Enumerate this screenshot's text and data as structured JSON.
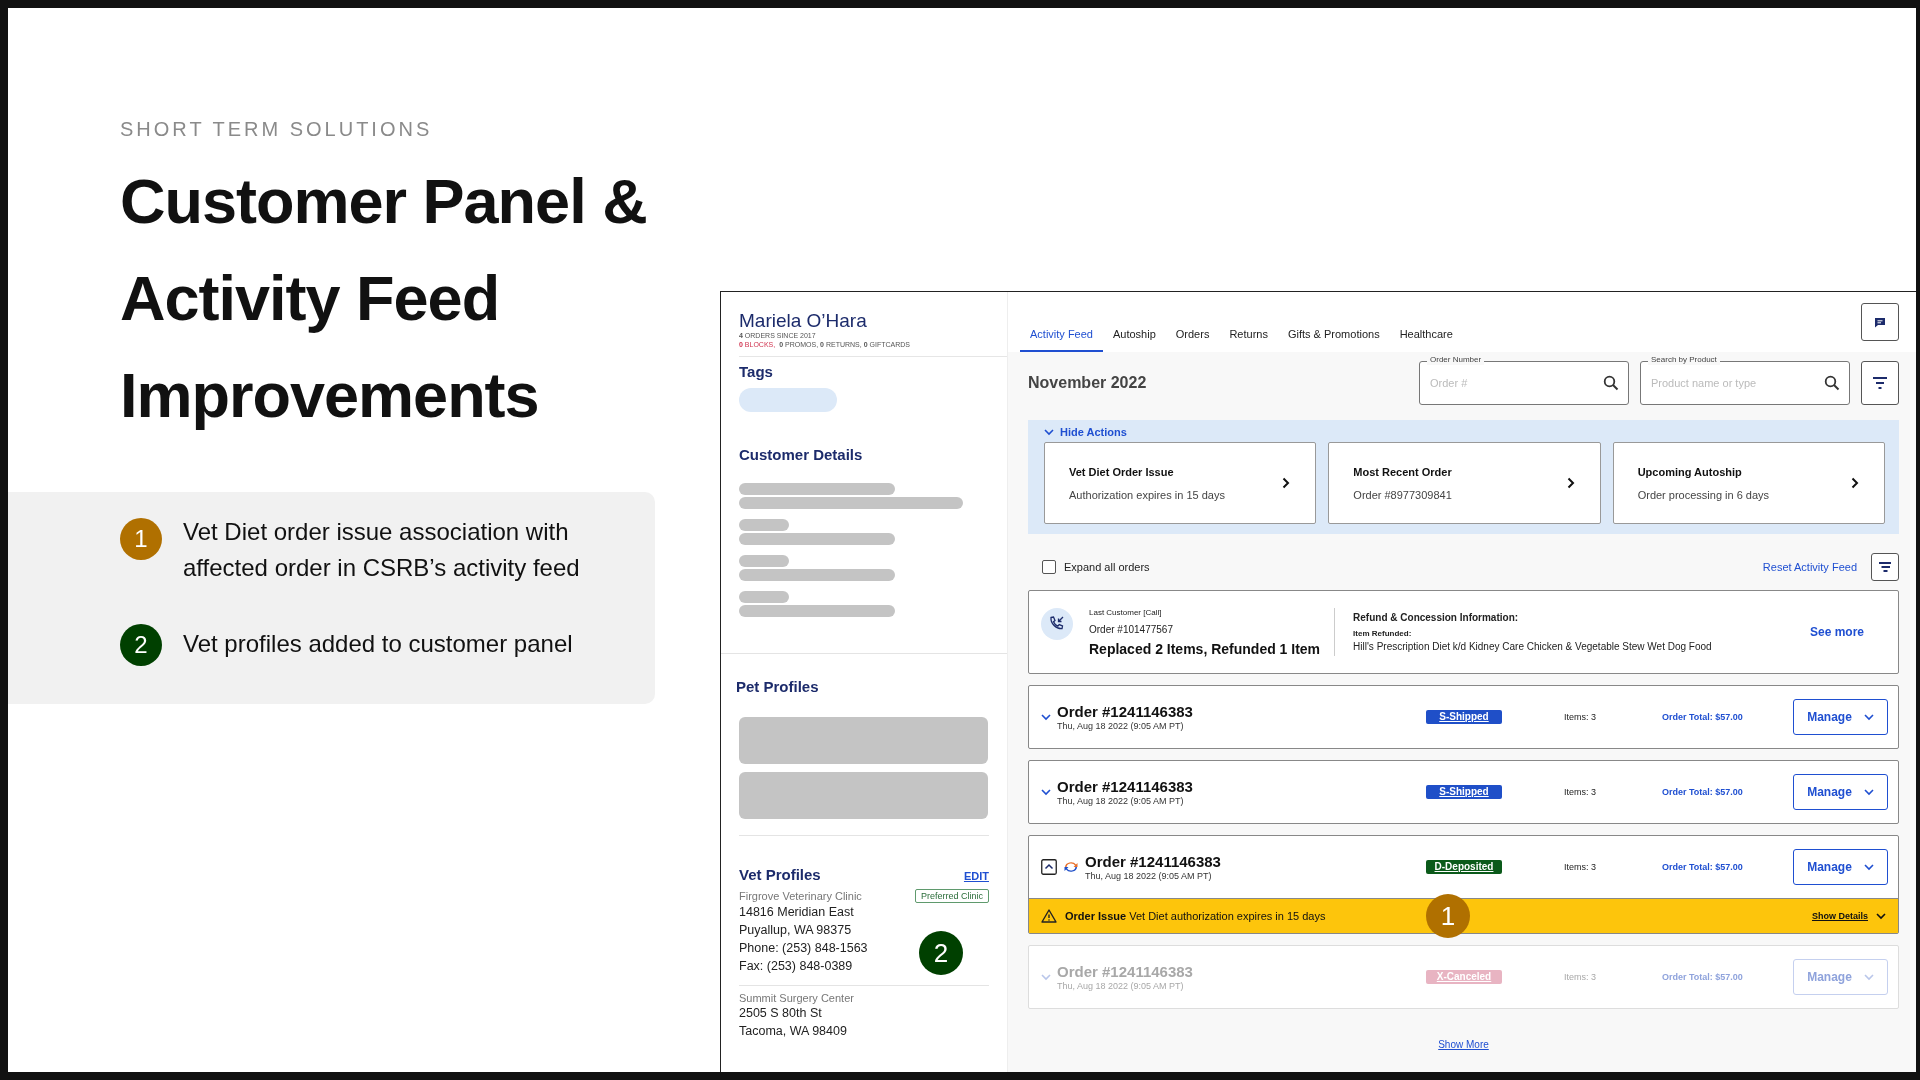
{
  "slide": {
    "eyebrow": "SHORT TERM SOLUTIONS",
    "title_lines": [
      "Customer Panel &",
      "Activity Feed",
      "Improvements"
    ],
    "notes": [
      {
        "marker": "1",
        "color": "#b07000",
        "text": "Vet Diet order issue association with affected order in CSRB’s activity feed"
      },
      {
        "marker": "2",
        "color": "#004000",
        "text": "Vet profiles added to customer panel"
      }
    ]
  },
  "customer_panel": {
    "name": "Mariela O’Hara",
    "summary": "**4** ORDERS SINCE 2017",
    "alerts": "**0** BLOCKS,",
    "counts": "**0** PROMOS, **0** RETURNS, **0** GIFTCARDS",
    "tags_heading": "Tags",
    "details_heading": "Customer Details",
    "pets_heading": "Pet Profiles",
    "vets_heading": "Vet Profiles",
    "vets_edit": "EDIT",
    "vets": [
      {
        "clinic": "Firgrove Veterinary Clinic",
        "badge": "Preferred Clinic",
        "lines": [
          "14816 Meridian East",
          "Puyallup, WA 98375",
          "Phone: (253) 848-1563",
          "Fax: (253) 848-0389"
        ],
        "callout": {
          "label": "2",
          "color": "#004000"
        }
      },
      {
        "clinic": "Summit Surgery Center",
        "lines": [
          "2505 S 80th St",
          "Tacoma, WA 98409"
        ]
      }
    ]
  },
  "tabs": [
    {
      "label": "Activity Feed",
      "selected": true
    },
    {
      "label": "Autoship",
      "selected": false
    },
    {
      "label": "Orders",
      "selected": false
    },
    {
      "label": "Returns",
      "selected": false
    },
    {
      "label": "Gifts & Promotions",
      "selected": false
    },
    {
      "label": "Healthcare",
      "selected": false
    }
  ],
  "month": "November 2022",
  "search_fields": [
    {
      "label": "Order Number",
      "placeholder": "Order #"
    },
    {
      "label": "Search by Product",
      "placeholder": "Product name or type"
    }
  ],
  "actions": {
    "toggle": "Hide Actions",
    "expanded": true,
    "cards": [
      {
        "title": "Vet Diet Order Issue",
        "detail": "Authorization expires in 15 days"
      },
      {
        "title": "Most Recent Order",
        "detail": "Order #8977309841"
      },
      {
        "title": "Upcoming Autoship",
        "detail": "Order processing in 6 days"
      }
    ]
  },
  "expand_all": {
    "label": "Expand all orders",
    "checked": false
  },
  "reset": "Reset Activity Feed",
  "last_contact": {
    "label": "Last Customer [Call]",
    "order": "Order #101477567",
    "summary": "Replaced 2 Items, Refunded 1 Item",
    "info_title": "Refund & Concession Information:",
    "item_label": "Item Refunded:",
    "item": "Hill's Prescription Diet k/d Kidney Care Chicken & Vegetable Stew Wet Dog Food",
    "link": "See more"
  },
  "orders": [
    {
      "number": "Order #1241146383",
      "date": "Thu, Aug 18 2022 (9:05 AM PT)",
      "status": {
        "text": "S-Shipped",
        "color": "#1f4fc8"
      },
      "items": "Items: 3",
      "total": "Order Total: $57.00",
      "manage": "Manage",
      "expanded": false,
      "disabled": false,
      "autoship": false
    },
    {
      "number": "Order #1241146383",
      "date": "Thu, Aug 18 2022 (9:05 AM PT)",
      "status": {
        "text": "S-Shipped",
        "color": "#1f4fc8"
      },
      "items": "Items: 3",
      "total": "Order Total: $57.00",
      "manage": "Manage",
      "expanded": false,
      "disabled": false,
      "autoship": false
    },
    {
      "number": "Order #1241146383",
      "date": "Thu, Aug 18 2022 (9:05 AM PT)",
      "status": {
        "text": "D-Deposited",
        "color": "#0b5a1a"
      },
      "items": "Items: 3",
      "total": "Order Total: $57.00",
      "manage": "Manage",
      "expanded": true,
      "disabled": false,
      "autoship": true,
      "issue": {
        "label": "Order Issue",
        "text": "Vet Diet authorization expires in 15 days",
        "link": "Show Details",
        "callout": {
          "label": "1",
          "color": "#b07000"
        }
      }
    },
    {
      "number": "Order #1241146383",
      "date": "Thu, Aug 18 2022 (9:05 AM PT)",
      "status": {
        "text": "X-Canceled",
        "color": "#e8b4c2"
      },
      "items": "Items: 3",
      "total": "Order Total: $57.00",
      "manage": "Manage",
      "expanded": false,
      "disabled": true,
      "autoship": false
    }
  ],
  "show_more": "Show More"
}
